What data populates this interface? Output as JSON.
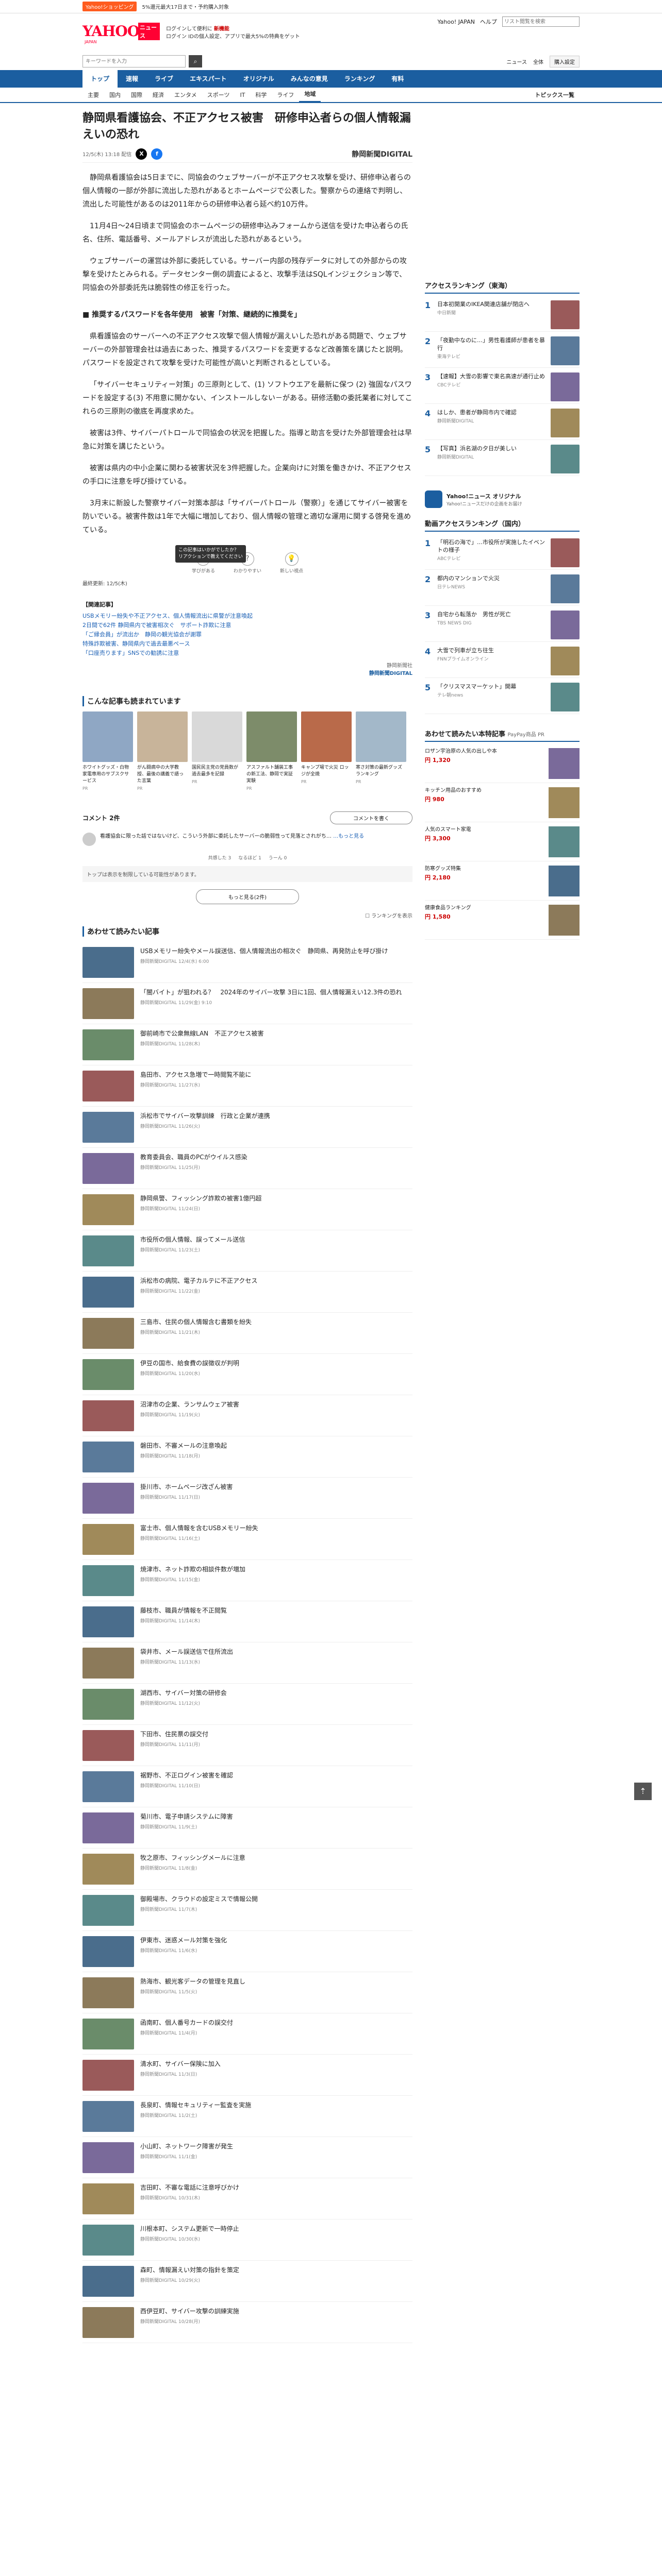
{
  "topstrip": {
    "badge": "Yahoo!ショッピング",
    "text": "5%還元最大17日まで・予約購入対象"
  },
  "header": {
    "logo": "YAHOO!",
    "logo_sub": "JAPAN",
    "logo_news": "ニュース",
    "mid_line1": "ログインして便利に",
    "mid_hl": "新機能",
    "mid_line2": "ログイン IDの個人設定、アプリで最大5%の特典をゲット",
    "links": [
      "Yahoo! JAPAN",
      "ヘルプ"
    ],
    "search_ph": "リスト閲覧を検索"
  },
  "searchrow": {
    "placeholder": "キーワードを入力",
    "links": [
      "ニュース",
      "全体"
    ],
    "login": "購入設定"
  },
  "nav1": [
    "トップ",
    "速報",
    "ライブ",
    "エキスパート",
    "オリジナル",
    "みんなの意見",
    "ランキング",
    "有料"
  ],
  "nav2": [
    "主要",
    "国内",
    "国際",
    "経済",
    "エンタメ",
    "スポーツ",
    "IT",
    "科学",
    "ライフ",
    "地域"
  ],
  "nav2_topics": "トピックス一覧",
  "article": {
    "title": "静岡県看護協会、不正アクセス被害　研修申込者らの個人情報漏えいの恐れ",
    "date": "12/5(木) 13:18 配信",
    "share": [
      "X",
      "f"
    ],
    "source": "静岡新聞DIGITAL",
    "p": [
      "静岡県看護協会は5日までに、同協会のウェブサーバーが不正アクセス攻撃を受け、研修申込者らの個人情報の一部が外部に流出した恐れがあるとホームページで公表した。警察からの連絡で判明し、流出した可能性があるのは2011年からの研修申込者ら延べ約10万件。",
      "11月4日〜24日頃まで同協会のホームページの研修申込みフォームから送信を受けた申込者らの氏名、住所、電話番号、メールアドレスが流出した恐れがあるという。",
      "ウェブサーバーの運営は外部に委託している。サーバー内部の残存データに対しての外部からの攻撃を受けたとみられる。データセンター側の調査によると、攻撃手法はSQLインジェクション等で、同協会の外部委託先は脆弱性の修正を行った。",
      "■ 推奨するパスワードを各年使用　被害「対策、継続的に推奨を」",
      "県看護協会のサーバーへの不正アクセス攻撃で個人情報が漏えいした恐れがある問題で、ウェブサーバーの外部管理会社は過去にあった、推奨するパスワードを変更するなど改善策を講じたと説明。パスワードを設定されて攻撃を受けた可能性が高いと判断されるとしている。",
      "「サイバーセキュリティー対策」の三原則として、(1) ソフトウエアを最新に保つ (2) 強固なパスワードを設定する(3) 不用意に開かない、インストールしない－がある。研修活動の委託業者に対してこれらの三原則の徹底を再度求めた。",
      "被害は3件、サイバーパトロールで同協会の状況を把握した。指導と助言を受けた外部管理会社は早急に対策を講じたという。",
      "被害は県内の中小企業に関わる被害状況を3件把握した。企業向けに対策を働きかけ、不正アクセスの手口に注意を呼び掛けている。",
      "3月末に新設した警察サイバー対策本部は「サイバーパトロール（警察）」を通じてサイバー被害を防いでいる。被害件数は1年で大幅に増加しており、個人情報の管理と適切な運用に関する啓発を進めている。"
    ],
    "reactions": [
      {
        "icon": "🎓",
        "label": "学びがある"
      },
      {
        "icon": "?",
        "label": "わかりやすい"
      },
      {
        "icon": "💡",
        "label": "新しい視点"
      }
    ],
    "tip": "この記事はいかがでしたか？\nリアクションで教えてください",
    "views": "最終更新: 12/5(木)",
    "related_head": "【関連記事】",
    "related": [
      "USBメモリー紛失や不正アクセス、個人情報流出に県警が注意喚起",
      "2日間で62件 静岡県内で被害相次ぐ　サポート詐欺に注意",
      "「ご縁会員」が流出か　静岡の観光協会が謝罪",
      "特殊詐欺被害、静岡県内で過去最悪ペース",
      "「口座売ります」SNSでの勧誘に注意"
    ],
    "credit": "静岡新聞社",
    "credit_src": "静岡新聞DIGITAL"
  },
  "recommend": {
    "title": "こんな記事も読まれています",
    "cards": [
      {
        "t": "ホワイトグッズ・白物家電専用のサブスクサービス",
        "s": "PR"
      },
      {
        "t": "がん闘病中の大学教授、最後の講義で語った言葉",
        "s": "PR"
      },
      {
        "t": "国民民主党の党員数が過去最多を記録",
        "s": "PR"
      },
      {
        "t": "アスファルト舗装工事の新工法、静岡で実証実験",
        "s": "PR"
      },
      {
        "t": "キャンプ場で火災 ロッジが全焼",
        "s": "PR"
      },
      {
        "t": "寒さ対策の最新グッズランキング",
        "s": "PR"
      }
    ]
  },
  "comments": {
    "title": "コメント 2件",
    "write": "コメントを書く",
    "items": [
      {
        "text": "看護協会に限った話ではないけど、こういう外部に委託したサーバーの脆弱性って見落とされがち…",
        "more": "…もっと見る"
      }
    ],
    "actions": [
      "共感した 3",
      "なるほど 1",
      "うーん 0"
    ],
    "note": "トップは表示を制限している可能性があります。",
    "more": "もっと見る(2件)"
  },
  "checkbox_label": "ランキングを表示",
  "related_list": {
    "title": "あわせて読みたい記事",
    "items": [
      {
        "t": "USBメモリー紛失やメール誤送信、個人情報流出の相次ぐ　静岡県、再発防止を呼び掛け",
        "s": "静岡新聞DIGITAL 12/4(水) 6:00"
      },
      {
        "t": "「闇バイト」が狙われる？　2024年のサイバー攻撃 3日に1回、個人情報漏えい12.3件の恐れ",
        "s": "静岡新聞DIGITAL 11/29(金) 9:10"
      },
      {
        "t": "御前崎市で公衆無線LAN　不正アクセス被害",
        "s": "静岡新聞DIGITAL 11/28(木)"
      },
      {
        "t": "島田市、アクセス急増で一時閲覧不能に",
        "s": "静岡新聞DIGITAL 11/27(水)"
      },
      {
        "t": "浜松市でサイバー攻撃訓練　行政と企業が連携",
        "s": "静岡新聞DIGITAL 11/26(火)"
      },
      {
        "t": "教育委員会、職員のPCがウイルス感染",
        "s": "静岡新聞DIGITAL 11/25(月)"
      },
      {
        "t": "静岡県警、フィッシング詐欺の被害1億円超",
        "s": "静岡新聞DIGITAL 11/24(日)"
      },
      {
        "t": "市役所の個人情報、誤ってメール送信",
        "s": "静岡新聞DIGITAL 11/23(土)"
      },
      {
        "t": "浜松市の病院、電子カルテに不正アクセス",
        "s": "静岡新聞DIGITAL 11/22(金)"
      },
      {
        "t": "三島市、住民の個人情報含む書類を紛失",
        "s": "静岡新聞DIGITAL 11/21(木)"
      },
      {
        "t": "伊豆の国市、給食費の誤徴収が判明",
        "s": "静岡新聞DIGITAL 11/20(水)"
      },
      {
        "t": "沼津市の企業、ランサムウェア被害",
        "s": "静岡新聞DIGITAL 11/19(火)"
      },
      {
        "t": "磐田市、不審メールの注意喚起",
        "s": "静岡新聞DIGITAL 11/18(月)"
      },
      {
        "t": "掛川市、ホームページ改ざん被害",
        "s": "静岡新聞DIGITAL 11/17(日)"
      },
      {
        "t": "富士市、個人情報を含むUSBメモリー紛失",
        "s": "静岡新聞DIGITAL 11/16(土)"
      },
      {
        "t": "焼津市、ネット詐欺の相談件数が増加",
        "s": "静岡新聞DIGITAL 11/15(金)"
      },
      {
        "t": "藤枝市、職員が情報を不正閲覧",
        "s": "静岡新聞DIGITAL 11/14(木)"
      },
      {
        "t": "袋井市、メール誤送信で住所流出",
        "s": "静岡新聞DIGITAL 11/13(水)"
      },
      {
        "t": "湖西市、サイバー対策の研修会",
        "s": "静岡新聞DIGITAL 11/12(火)"
      },
      {
        "t": "下田市、住民票の誤交付",
        "s": "静岡新聞DIGITAL 11/11(月)"
      },
      {
        "t": "裾野市、不正ログイン被害を確認",
        "s": "静岡新聞DIGITAL 11/10(日)"
      },
      {
        "t": "菊川市、電子申請システムに障害",
        "s": "静岡新聞DIGITAL 11/9(土)"
      },
      {
        "t": "牧之原市、フィッシングメールに注意",
        "s": "静岡新聞DIGITAL 11/8(金)"
      },
      {
        "t": "御殿場市、クラウドの設定ミスで情報公開",
        "s": "静岡新聞DIGITAL 11/7(木)"
      },
      {
        "t": "伊東市、迷惑メール対策を強化",
        "s": "静岡新聞DIGITAL 11/6(水)"
      },
      {
        "t": "熱海市、観光客データの管理を見直し",
        "s": "静岡新聞DIGITAL 11/5(火)"
      },
      {
        "t": "函南町、個人番号カードの誤交付",
        "s": "静岡新聞DIGITAL 11/4(月)"
      },
      {
        "t": "清水町、サイバー保険に加入",
        "s": "静岡新聞DIGITAL 11/3(日)"
      },
      {
        "t": "長泉町、情報セキュリティー監査を実施",
        "s": "静岡新聞DIGITAL 11/2(土)"
      },
      {
        "t": "小山町、ネットワーク障害が発生",
        "s": "静岡新聞DIGITAL 11/1(金)"
      },
      {
        "t": "吉田町、不審な電話に注意呼びかけ",
        "s": "静岡新聞DIGITAL 10/31(木)"
      },
      {
        "t": "川根本町、システム更新で一時停止",
        "s": "静岡新聞DIGITAL 10/30(水)"
      },
      {
        "t": "森町、情報漏えい対策の指針を策定",
        "s": "静岡新聞DIGITAL 10/29(火)"
      },
      {
        "t": "西伊豆町、サイバー攻撃の訓練実施",
        "s": "静岡新聞DIGITAL 10/28(月)"
      }
    ]
  },
  "side": {
    "rank1": {
      "title": "アクセスランキング（東海）",
      "items": [
        {
          "t": "日本初開業のIKEA関連店舗が閉店へ",
          "s": "中日新聞"
        },
        {
          "t": "「夜勤中なのに…」男性看護師が患者を暴行",
          "s": "東海テレビ"
        },
        {
          "t": "【速報】大雪の影響で東名高速が通行止め",
          "s": "CBCテレビ"
        },
        {
          "t": "はしか、患者が静岡市内で確認",
          "s": "静岡新聞DIGITAL"
        },
        {
          "t": "【写真】浜名湖の夕日が美しい",
          "s": "静岡新聞DIGITAL"
        }
      ]
    },
    "banner": {
      "title": "Yahoo!ニュース オリジナル",
      "sub": "Yahoo!ニュースだけの企画をお届け"
    },
    "rank2": {
      "title": "動画アクセスランキング（国内）",
      "items": [
        {
          "t": "「明石の海で」…市役所が実施したイベントの様子",
          "s": "ABCテレビ"
        },
        {
          "t": "都内のマンションで火災",
          "s": "日テレNEWS"
        },
        {
          "t": "自宅から転落か　男性が死亡",
          "s": "TBS NEWS DIG"
        },
        {
          "t": "大雪で列車が立ち往生",
          "s": "FNNプライムオンライン"
        },
        {
          "t": "「クリスマスマーケット」開幕",
          "s": "テレ朝news"
        }
      ]
    },
    "ads": {
      "title": "あわせて読みたい本特記事",
      "sub": "PayPay商品 PR",
      "items": [
        {
          "t": "ロザン宇治原の人気の出しや本",
          "p": "円 1,320"
        },
        {
          "t": "キッチン用品のおすすめ",
          "p": "円 980"
        },
        {
          "t": "人気のスマート家電",
          "p": "円 3,300"
        },
        {
          "t": "防寒グッズ特集",
          "p": "円 2,180"
        },
        {
          "t": "健康食品ランキング",
          "p": "円 1,580"
        }
      ]
    }
  },
  "colors": {
    "brand": "#1b5ea0",
    "logo": "#ff0033"
  },
  "icons": [
    "search-icon",
    "totop-icon",
    "share-x-icon",
    "share-facebook-icon"
  ]
}
